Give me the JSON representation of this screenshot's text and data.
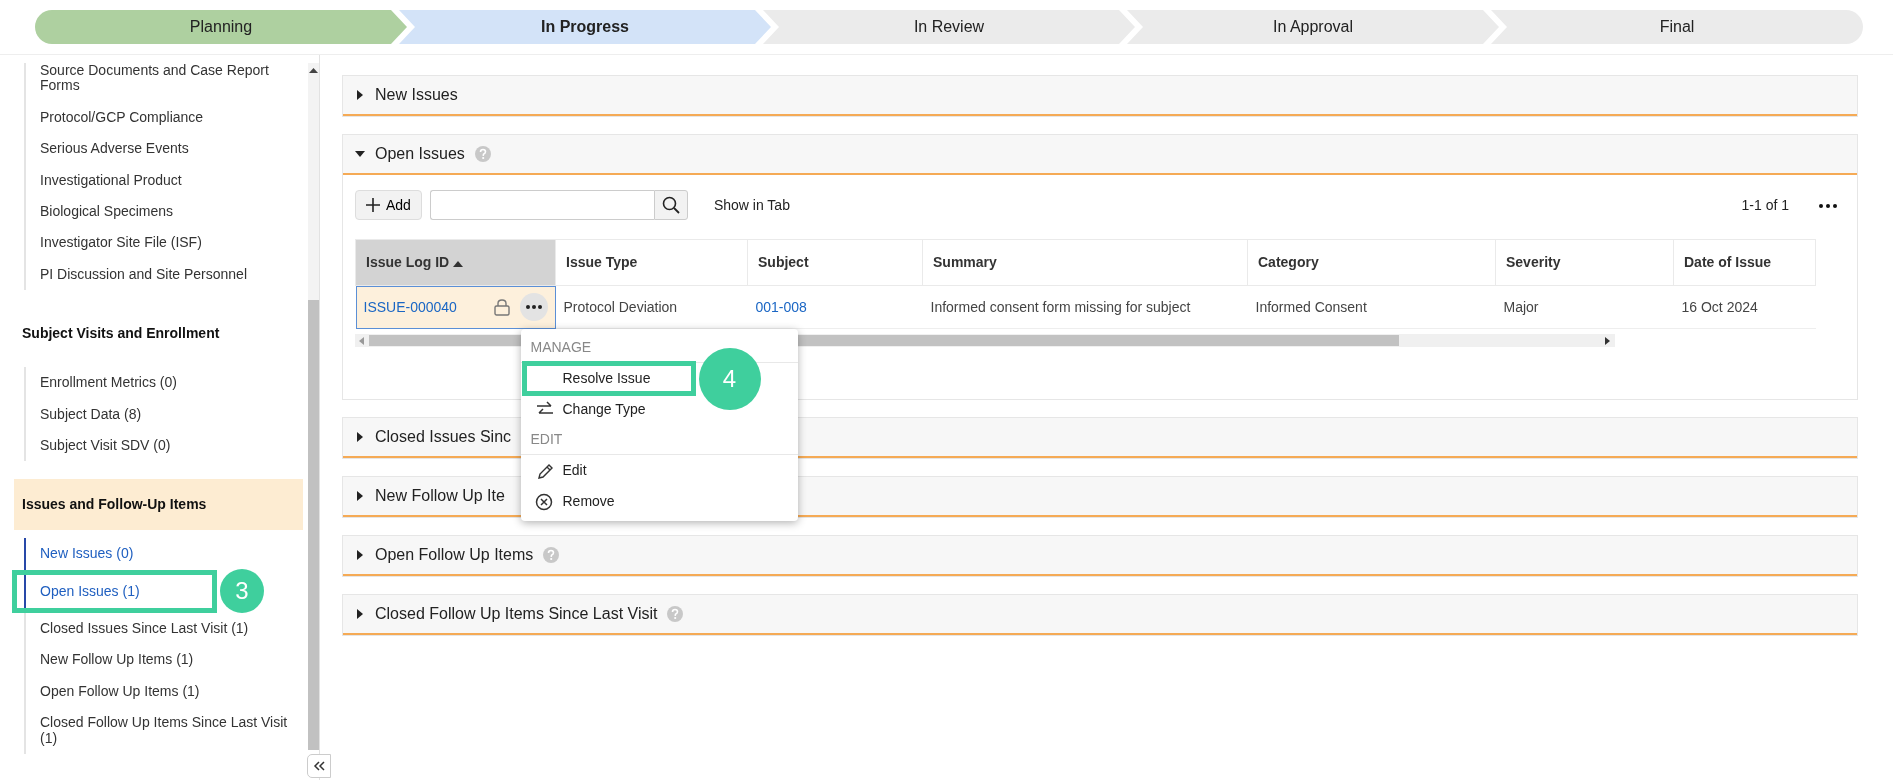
{
  "stepper": [
    {
      "label": "Planning",
      "done": true,
      "selected": false
    },
    {
      "label": "In Progress",
      "done": false,
      "selected": true
    },
    {
      "label": "In Review",
      "done": false,
      "selected": false
    },
    {
      "label": "In Approval",
      "done": false,
      "selected": false
    },
    {
      "label": "Final",
      "done": false,
      "selected": false
    }
  ],
  "sidebar": {
    "groups": [
      {
        "items": [
          {
            "label": "Source Documents and Case Report Forms",
            "selected": false
          },
          {
            "label": "Protocol/GCP Compliance",
            "selected": false
          },
          {
            "label": "Serious Adverse Events",
            "selected": false
          },
          {
            "label": "Investigational Product",
            "selected": false
          },
          {
            "label": "Biological Specimens",
            "selected": false
          },
          {
            "label": "Investigator Site File (ISF)",
            "selected": false
          },
          {
            "label": "PI Discussion and Site Personnel",
            "selected": false
          }
        ]
      },
      {
        "title": "Subject Visits and Enrollment",
        "selected": false,
        "items": [
          {
            "label": "Enrollment Metrics (0)",
            "selected": false
          },
          {
            "label": "Subject Data (8)",
            "selected": false
          },
          {
            "label": "Subject Visit SDV (0)",
            "selected": false
          }
        ]
      },
      {
        "title": "Issues and Follow-Up Items",
        "selected": true,
        "items": [
          {
            "label": "New Issues (0)",
            "selected": true
          },
          {
            "label": "Open Issues (1)",
            "selected": true,
            "callout": "3"
          },
          {
            "label": "Closed Issues Since Last Visit (1)",
            "selected": false
          },
          {
            "label": "New Follow Up Items (1)",
            "selected": false
          },
          {
            "label": "Open Follow Up Items (1)",
            "selected": false
          },
          {
            "label": "Closed Follow Up Items Since Last Visit (1)",
            "selected": false
          }
        ]
      }
    ]
  },
  "panels": [
    {
      "title": "New Issues",
      "expanded": false,
      "help": false
    },
    {
      "title": "Open Issues",
      "expanded": true,
      "help": true,
      "toolbar": {
        "add_label": "Add",
        "show_in_tab": "Show in Tab",
        "pager": "1-1 of 1"
      },
      "table": {
        "columns": [
          {
            "label": "Issue Log ID",
            "sorted": true
          },
          {
            "label": "Issue Type",
            "sorted": false
          },
          {
            "label": "Subject",
            "sorted": false
          },
          {
            "label": "Summary",
            "sorted": false
          },
          {
            "label": "Category",
            "sorted": false
          },
          {
            "label": "Severity",
            "sorted": false
          },
          {
            "label": "Date of Issue",
            "sorted": false
          }
        ],
        "rows": [
          {
            "cells": [
              {
                "text": "ISSUE-000040",
                "kind": "id"
              },
              {
                "text": "Protocol Deviation",
                "kind": "text"
              },
              {
                "text": "001-008",
                "kind": "link"
              },
              {
                "text": "Informed consent form missing for subject",
                "kind": "text"
              },
              {
                "text": "Informed Consent",
                "kind": "text"
              },
              {
                "text": "Major",
                "kind": "text"
              },
              {
                "text": "16 Oct 2024",
                "kind": "text"
              }
            ]
          }
        ]
      },
      "menu": {
        "sections": [
          {
            "header": "MANAGE",
            "items": [
              {
                "label": "Resolve Issue",
                "callout": "4"
              },
              {
                "label": "Change Type"
              }
            ]
          },
          {
            "header": "EDIT",
            "items": [
              {
                "label": "Edit"
              },
              {
                "label": "Remove"
              }
            ]
          }
        ]
      }
    },
    {
      "title": "Closed Issues Sinc",
      "expanded": false,
      "help": false
    },
    {
      "title": "New Follow Up Ite",
      "expanded": false,
      "help": false
    },
    {
      "title": "Open Follow Up Items",
      "expanded": false,
      "help": true
    },
    {
      "title": "Closed Follow Up Items Since Last Visit",
      "expanded": false,
      "help": true
    }
  ]
}
